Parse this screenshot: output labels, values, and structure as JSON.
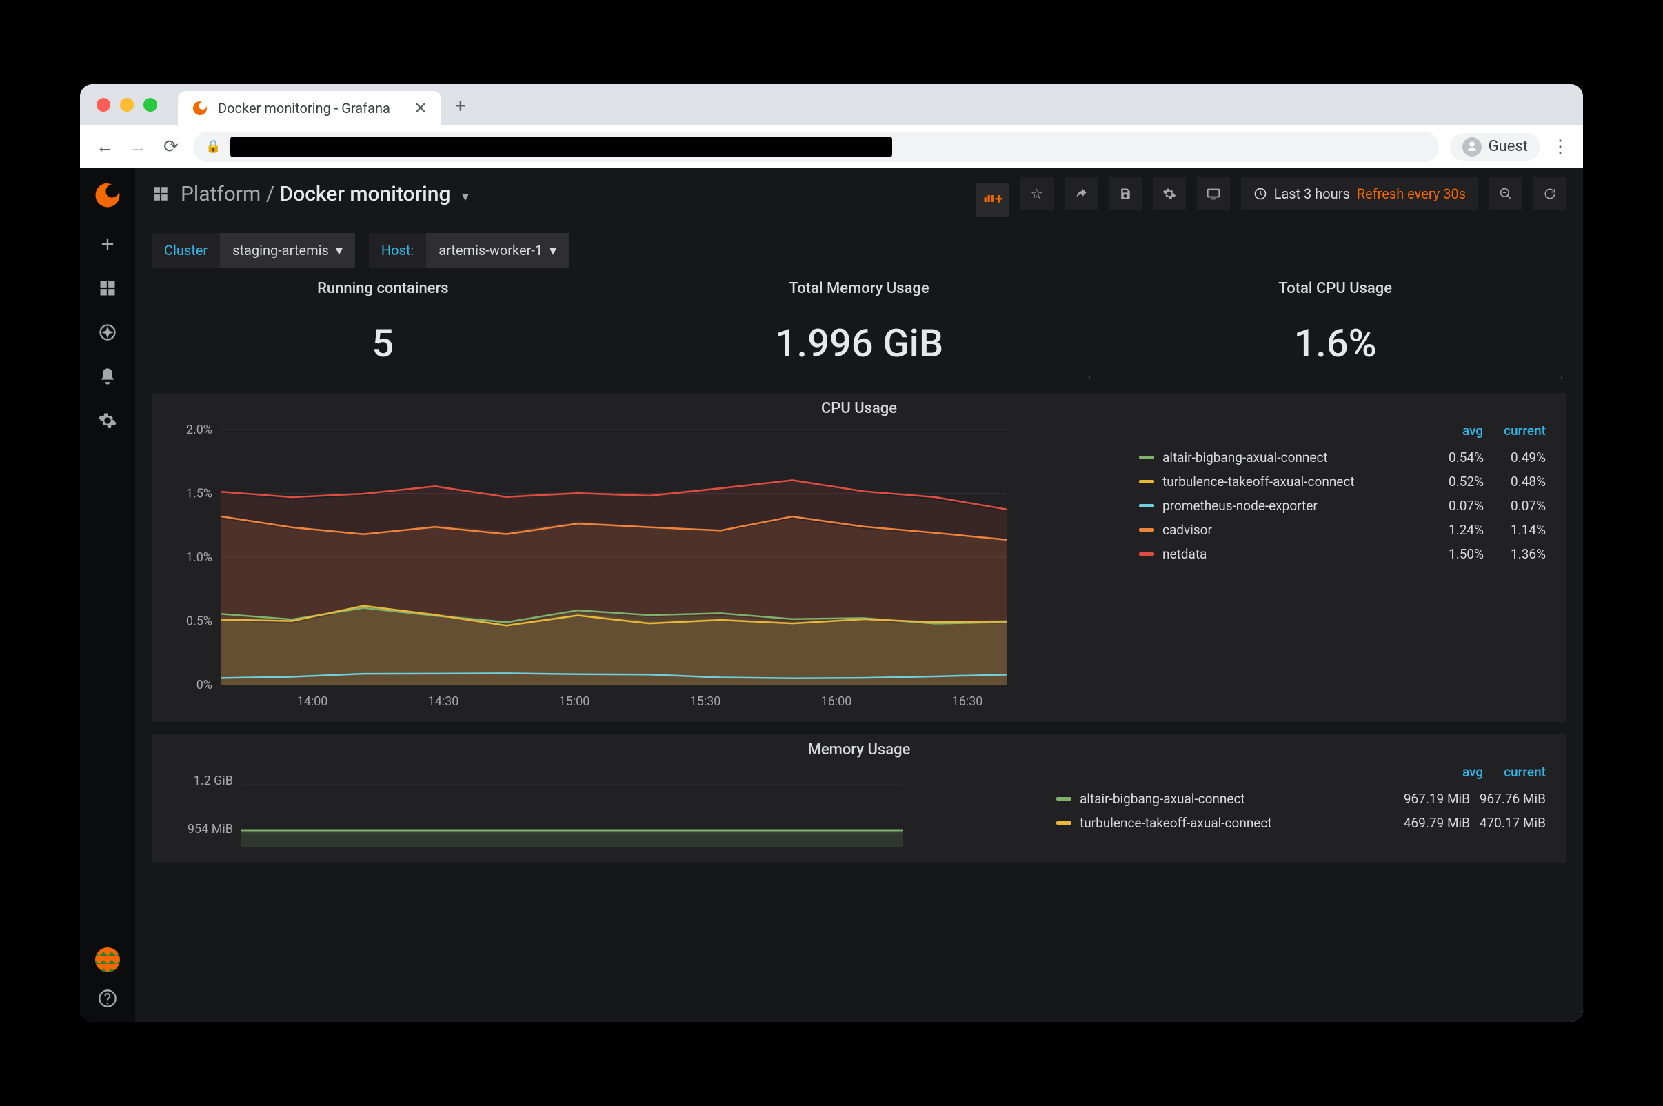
{
  "browser": {
    "tab_title": "Docker monitoring - Grafana",
    "guest_label": "Guest"
  },
  "topbar": {
    "breadcrumb_parent": "Platform",
    "breadcrumb_sep": " / ",
    "breadcrumb_current": "Docker monitoring",
    "time_range": "Last 3 hours",
    "refresh": "Refresh every 30s"
  },
  "filters": {
    "cluster_label": "Cluster",
    "cluster_value": "staging-artemis",
    "host_label": "Host:",
    "host_value": "artemis-worker-1"
  },
  "stats": [
    {
      "title": "Running containers",
      "value": "5"
    },
    {
      "title": "Total Memory Usage",
      "value": "1.996 GiB"
    },
    {
      "title": "Total CPU Usage",
      "value": "1.6%"
    }
  ],
  "cpu_panel": {
    "title": "CPU Usage",
    "legend_headers": {
      "avg": "avg",
      "current": "current"
    },
    "series": [
      {
        "name": "altair-bigbang-axual-connect",
        "color": "#7eb26d",
        "avg": "0.54%",
        "current": "0.49%"
      },
      {
        "name": "turbulence-takeoff-axual-connect",
        "color": "#eab839",
        "avg": "0.52%",
        "current": "0.48%"
      },
      {
        "name": "prometheus-node-exporter",
        "color": "#6ed0e0",
        "avg": "0.07%",
        "current": "0.07%"
      },
      {
        "name": "cadvisor",
        "color": "#ef843c",
        "avg": "1.24%",
        "current": "1.14%"
      },
      {
        "name": "netdata",
        "color": "#e24d42",
        "avg": "1.50%",
        "current": "1.36%"
      }
    ]
  },
  "mem_panel": {
    "title": "Memory Usage",
    "legend_headers": {
      "avg": "avg",
      "current": "current"
    },
    "series": [
      {
        "name": "altair-bigbang-axual-connect",
        "color": "#7eb26d",
        "avg": "967.19 MiB",
        "current": "967.76 MiB"
      },
      {
        "name": "turbulence-takeoff-axual-connect",
        "color": "#eab839",
        "avg": "469.79 MiB",
        "current": "470.17 MiB"
      }
    ]
  },
  "chart_data": [
    {
      "type": "line",
      "title": "CPU Usage",
      "ylabel": "",
      "xlabel": "",
      "ylim": [
        0,
        2.0
      ],
      "y_ticks": [
        "0%",
        "0.5%",
        "1.0%",
        "1.5%",
        "2.0%"
      ],
      "x_ticks": [
        "14:00",
        "14:30",
        "15:00",
        "15:30",
        "16:00",
        "16:30"
      ],
      "series": [
        {
          "name": "altair-bigbang-axual-connect",
          "color": "#7eb26d",
          "values": [
            0.55,
            0.52,
            0.62,
            0.56,
            0.5,
            0.58,
            0.53,
            0.54,
            0.5,
            0.52,
            0.49,
            0.51
          ]
        },
        {
          "name": "turbulence-takeoff-axual-connect",
          "color": "#eab839",
          "values": [
            0.5,
            0.48,
            0.6,
            0.54,
            0.47,
            0.56,
            0.5,
            0.52,
            0.48,
            0.5,
            0.47,
            0.48
          ]
        },
        {
          "name": "prometheus-node-exporter",
          "color": "#6ed0e0",
          "values": [
            0.07,
            0.07,
            0.08,
            0.07,
            0.07,
            0.07,
            0.08,
            0.07,
            0.07,
            0.07,
            0.07,
            0.07
          ]
        },
        {
          "name": "cadvisor",
          "color": "#ef843c",
          "values": [
            1.3,
            1.22,
            1.18,
            1.25,
            1.2,
            1.28,
            1.24,
            1.2,
            1.3,
            1.22,
            1.18,
            1.14
          ]
        },
        {
          "name": "netdata",
          "color": "#e24d42",
          "values": [
            1.5,
            1.45,
            1.48,
            1.55,
            1.48,
            1.52,
            1.5,
            1.55,
            1.6,
            1.5,
            1.45,
            1.36
          ]
        }
      ]
    },
    {
      "type": "line",
      "title": "Memory Usage",
      "ylabel": "",
      "xlabel": "",
      "y_ticks": [
        "954 MiB",
        "1.2 GiB"
      ],
      "series": [
        {
          "name": "altair-bigbang-axual-connect",
          "color": "#7eb26d",
          "values": [
            967,
            967,
            968,
            967,
            968,
            967,
            968,
            967,
            968,
            967,
            968,
            968
          ]
        }
      ]
    }
  ]
}
